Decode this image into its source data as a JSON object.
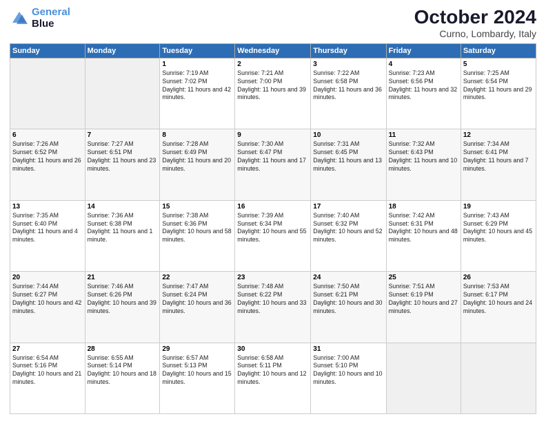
{
  "header": {
    "logo_line1": "General",
    "logo_line2": "Blue",
    "month": "October 2024",
    "location": "Curno, Lombardy, Italy"
  },
  "weekdays": [
    "Sunday",
    "Monday",
    "Tuesday",
    "Wednesday",
    "Thursday",
    "Friday",
    "Saturday"
  ],
  "weeks": [
    [
      {
        "day": "",
        "sunrise": "",
        "sunset": "",
        "daylight": ""
      },
      {
        "day": "",
        "sunrise": "",
        "sunset": "",
        "daylight": ""
      },
      {
        "day": "1",
        "sunrise": "Sunrise: 7:19 AM",
        "sunset": "Sunset: 7:02 PM",
        "daylight": "Daylight: 11 hours and 42 minutes."
      },
      {
        "day": "2",
        "sunrise": "Sunrise: 7:21 AM",
        "sunset": "Sunset: 7:00 PM",
        "daylight": "Daylight: 11 hours and 39 minutes."
      },
      {
        "day": "3",
        "sunrise": "Sunrise: 7:22 AM",
        "sunset": "Sunset: 6:58 PM",
        "daylight": "Daylight: 11 hours and 36 minutes."
      },
      {
        "day": "4",
        "sunrise": "Sunrise: 7:23 AM",
        "sunset": "Sunset: 6:56 PM",
        "daylight": "Daylight: 11 hours and 32 minutes."
      },
      {
        "day": "5",
        "sunrise": "Sunrise: 7:25 AM",
        "sunset": "Sunset: 6:54 PM",
        "daylight": "Daylight: 11 hours and 29 minutes."
      }
    ],
    [
      {
        "day": "6",
        "sunrise": "Sunrise: 7:26 AM",
        "sunset": "Sunset: 6:52 PM",
        "daylight": "Daylight: 11 hours and 26 minutes."
      },
      {
        "day": "7",
        "sunrise": "Sunrise: 7:27 AM",
        "sunset": "Sunset: 6:51 PM",
        "daylight": "Daylight: 11 hours and 23 minutes."
      },
      {
        "day": "8",
        "sunrise": "Sunrise: 7:28 AM",
        "sunset": "Sunset: 6:49 PM",
        "daylight": "Daylight: 11 hours and 20 minutes."
      },
      {
        "day": "9",
        "sunrise": "Sunrise: 7:30 AM",
        "sunset": "Sunset: 6:47 PM",
        "daylight": "Daylight: 11 hours and 17 minutes."
      },
      {
        "day": "10",
        "sunrise": "Sunrise: 7:31 AM",
        "sunset": "Sunset: 6:45 PM",
        "daylight": "Daylight: 11 hours and 13 minutes."
      },
      {
        "day": "11",
        "sunrise": "Sunrise: 7:32 AM",
        "sunset": "Sunset: 6:43 PM",
        "daylight": "Daylight: 11 hours and 10 minutes."
      },
      {
        "day": "12",
        "sunrise": "Sunrise: 7:34 AM",
        "sunset": "Sunset: 6:41 PM",
        "daylight": "Daylight: 11 hours and 7 minutes."
      }
    ],
    [
      {
        "day": "13",
        "sunrise": "Sunrise: 7:35 AM",
        "sunset": "Sunset: 6:40 PM",
        "daylight": "Daylight: 11 hours and 4 minutes."
      },
      {
        "day": "14",
        "sunrise": "Sunrise: 7:36 AM",
        "sunset": "Sunset: 6:38 PM",
        "daylight": "Daylight: 11 hours and 1 minute."
      },
      {
        "day": "15",
        "sunrise": "Sunrise: 7:38 AM",
        "sunset": "Sunset: 6:36 PM",
        "daylight": "Daylight: 10 hours and 58 minutes."
      },
      {
        "day": "16",
        "sunrise": "Sunrise: 7:39 AM",
        "sunset": "Sunset: 6:34 PM",
        "daylight": "Daylight: 10 hours and 55 minutes."
      },
      {
        "day": "17",
        "sunrise": "Sunrise: 7:40 AM",
        "sunset": "Sunset: 6:32 PM",
        "daylight": "Daylight: 10 hours and 52 minutes."
      },
      {
        "day": "18",
        "sunrise": "Sunrise: 7:42 AM",
        "sunset": "Sunset: 6:31 PM",
        "daylight": "Daylight: 10 hours and 48 minutes."
      },
      {
        "day": "19",
        "sunrise": "Sunrise: 7:43 AM",
        "sunset": "Sunset: 6:29 PM",
        "daylight": "Daylight: 10 hours and 45 minutes."
      }
    ],
    [
      {
        "day": "20",
        "sunrise": "Sunrise: 7:44 AM",
        "sunset": "Sunset: 6:27 PM",
        "daylight": "Daylight: 10 hours and 42 minutes."
      },
      {
        "day": "21",
        "sunrise": "Sunrise: 7:46 AM",
        "sunset": "Sunset: 6:26 PM",
        "daylight": "Daylight: 10 hours and 39 minutes."
      },
      {
        "day": "22",
        "sunrise": "Sunrise: 7:47 AM",
        "sunset": "Sunset: 6:24 PM",
        "daylight": "Daylight: 10 hours and 36 minutes."
      },
      {
        "day": "23",
        "sunrise": "Sunrise: 7:48 AM",
        "sunset": "Sunset: 6:22 PM",
        "daylight": "Daylight: 10 hours and 33 minutes."
      },
      {
        "day": "24",
        "sunrise": "Sunrise: 7:50 AM",
        "sunset": "Sunset: 6:21 PM",
        "daylight": "Daylight: 10 hours and 30 minutes."
      },
      {
        "day": "25",
        "sunrise": "Sunrise: 7:51 AM",
        "sunset": "Sunset: 6:19 PM",
        "daylight": "Daylight: 10 hours and 27 minutes."
      },
      {
        "day": "26",
        "sunrise": "Sunrise: 7:53 AM",
        "sunset": "Sunset: 6:17 PM",
        "daylight": "Daylight: 10 hours and 24 minutes."
      }
    ],
    [
      {
        "day": "27",
        "sunrise": "Sunrise: 6:54 AM",
        "sunset": "Sunset: 5:16 PM",
        "daylight": "Daylight: 10 hours and 21 minutes."
      },
      {
        "day": "28",
        "sunrise": "Sunrise: 6:55 AM",
        "sunset": "Sunset: 5:14 PM",
        "daylight": "Daylight: 10 hours and 18 minutes."
      },
      {
        "day": "29",
        "sunrise": "Sunrise: 6:57 AM",
        "sunset": "Sunset: 5:13 PM",
        "daylight": "Daylight: 10 hours and 15 minutes."
      },
      {
        "day": "30",
        "sunrise": "Sunrise: 6:58 AM",
        "sunset": "Sunset: 5:11 PM",
        "daylight": "Daylight: 10 hours and 12 minutes."
      },
      {
        "day": "31",
        "sunrise": "Sunrise: 7:00 AM",
        "sunset": "Sunset: 5:10 PM",
        "daylight": "Daylight: 10 hours and 10 minutes."
      },
      {
        "day": "",
        "sunrise": "",
        "sunset": "",
        "daylight": ""
      },
      {
        "day": "",
        "sunrise": "",
        "sunset": "",
        "daylight": ""
      }
    ]
  ]
}
